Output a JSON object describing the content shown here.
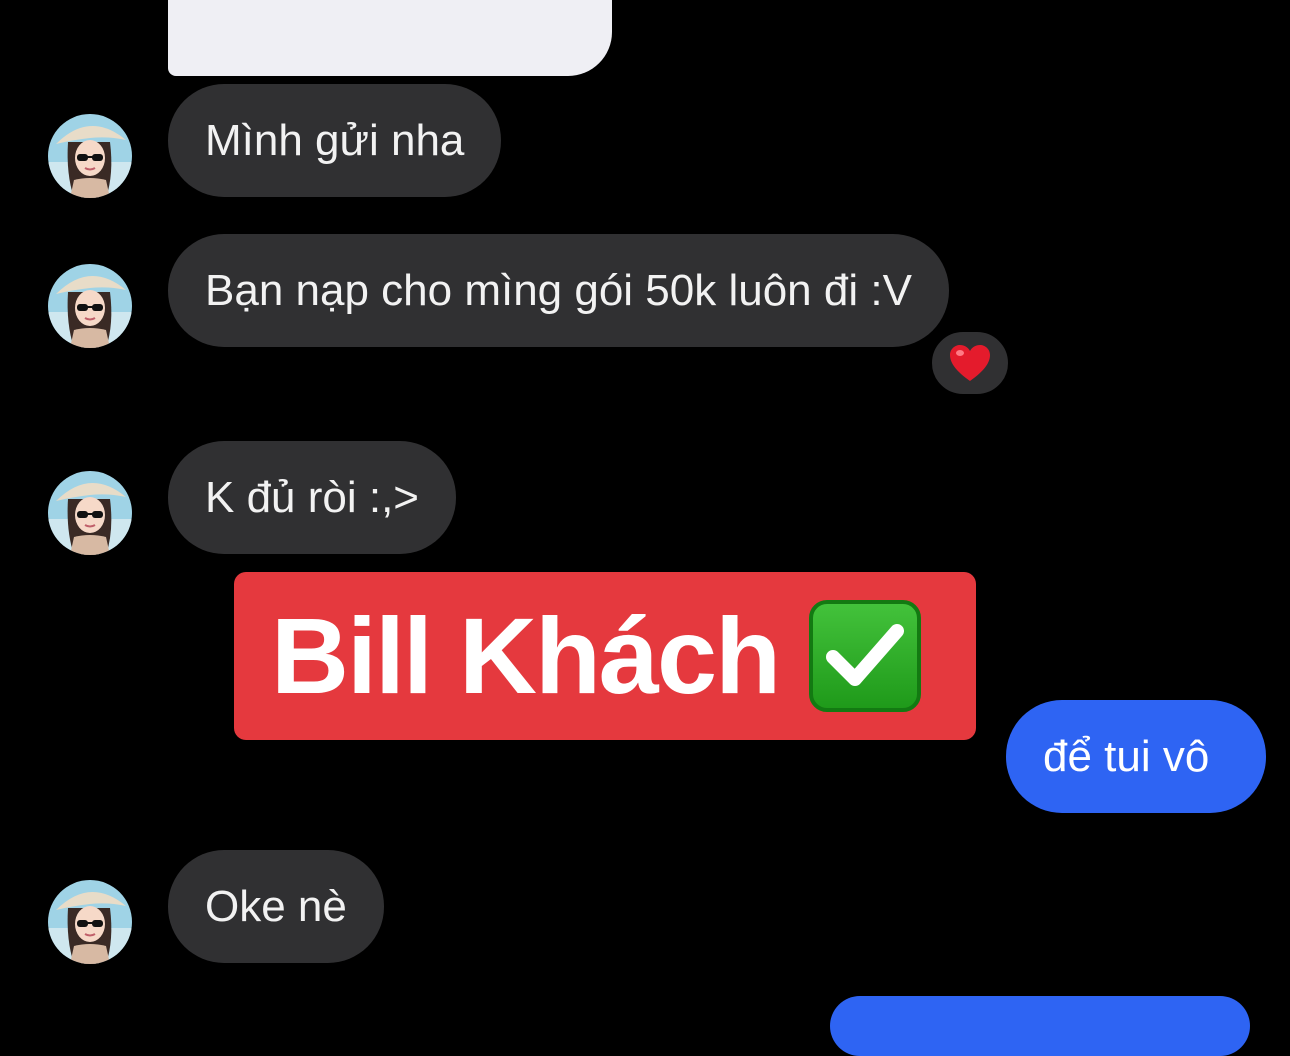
{
  "conversation": {
    "messages": [
      {
        "sender": "contact",
        "text": "Mình gửi nha"
      },
      {
        "sender": "contact",
        "text": "Bạn nạp cho mìng gói 50k luôn đi :V",
        "reaction": "heart-emoji"
      },
      {
        "sender": "contact",
        "text": "K đủ ròi :,>"
      },
      {
        "sender": "me",
        "text": "để tui vô"
      },
      {
        "sender": "contact",
        "text": "Oke nè"
      }
    ]
  },
  "overlay": {
    "banner_text": "Bill Khách",
    "banner_icon": "check-mark-button-emoji"
  },
  "colors": {
    "background": "#000000",
    "incoming_bubble": "#303032",
    "outgoing_bubble": "#2e64f3",
    "banner": "#e5393e",
    "check_green": "#2fae2a"
  }
}
